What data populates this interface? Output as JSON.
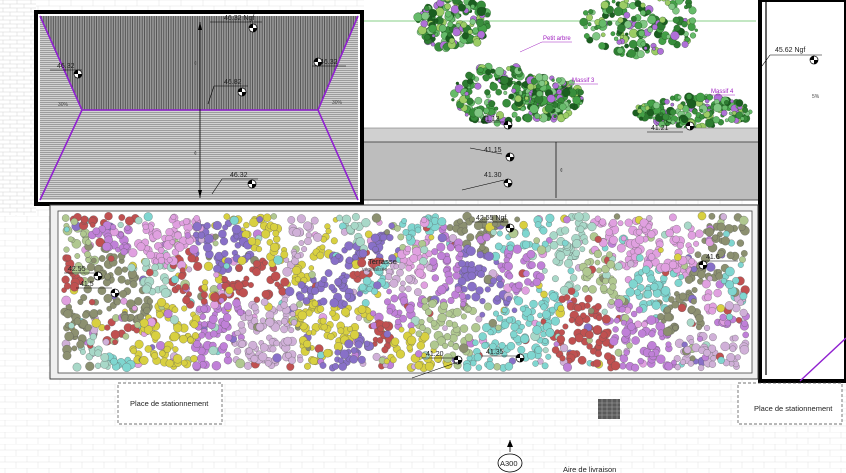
{
  "levels": {
    "roof_top": "46.32 Ngf",
    "roof_left": "46.32",
    "roof_right": "46.32",
    "roof_ridge": "46.82",
    "roof_bottom": "46.32",
    "right_building": "45.62 Ngf",
    "ground_a": "41.13",
    "ground_b": "41.15",
    "ground_c": "41.30",
    "terrace_top": "42.55 Ngf",
    "terrace_left_a": "42.55",
    "terrace_left_b": "41.5",
    "terrace_right": "41.6",
    "bottom_a": "41.20",
    "bottom_b": "41.35",
    "massif_level": "41.21"
  },
  "plants": {
    "petit_arbre": "Petit arbre",
    "massif_3": "Massif 3",
    "massif_4": "Massif 4"
  },
  "slopes": {
    "left": "30%",
    "right": "30%",
    "far_right": "5%"
  },
  "terrace": {
    "label": "Terrasse",
    "sublabel": "végétalisée"
  },
  "parking": {
    "left": "Place de stationnement",
    "right": "Place de stationnement"
  },
  "section_marker": "A300",
  "delivery_area": "Aire de livraison",
  "colors": {
    "roof_outline": "#9020d0",
    "wall": "#000000",
    "palette": [
      "#e0a0e0",
      "#c080d8",
      "#7fd6d0",
      "#b0c890",
      "#8c9070",
      "#c05050",
      "#d8d040",
      "#8870c8",
      "#d0b0d8",
      "#a8d8c8"
    ]
  }
}
